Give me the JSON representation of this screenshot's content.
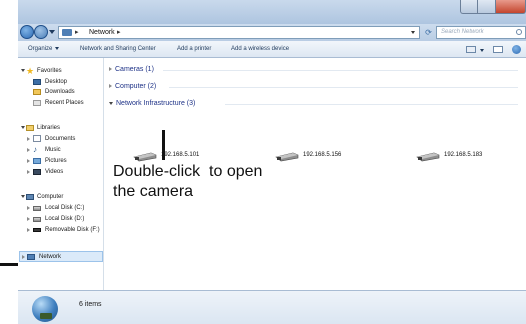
{
  "address": {
    "location": "Network",
    "search_placeholder": "Search Network"
  },
  "toolbar": {
    "organize": "Organize",
    "network_sharing_center": "Network and Sharing Center",
    "add_printer": "Add a printer",
    "add_wireless": "Add a wireless device"
  },
  "nav": {
    "favorites": "Favorites",
    "desktop": "Desktop",
    "downloads": "Downloads",
    "recent_places": "Recent Places",
    "libraries": "Libraries",
    "documents": "Documents",
    "music": "Music",
    "pictures": "Pictures",
    "videos": "Videos",
    "computer": "Computer",
    "local_c": "Local Disk (C:)",
    "local_d": "Local Disk (D:)",
    "removable_f": "Removable Disk (F:)",
    "network": "Network"
  },
  "groups": {
    "cameras": "Cameras (1)",
    "computer": "Computer (2)",
    "infrastructure": "Network Infrastructure (3)"
  },
  "devices": [
    "192.168.5.101",
    "192.168.5.156",
    "192.168.5.183"
  ],
  "callout": {
    "line1": "Double-click  to open",
    "line2": "the camera"
  },
  "status": {
    "items": "6 items"
  }
}
